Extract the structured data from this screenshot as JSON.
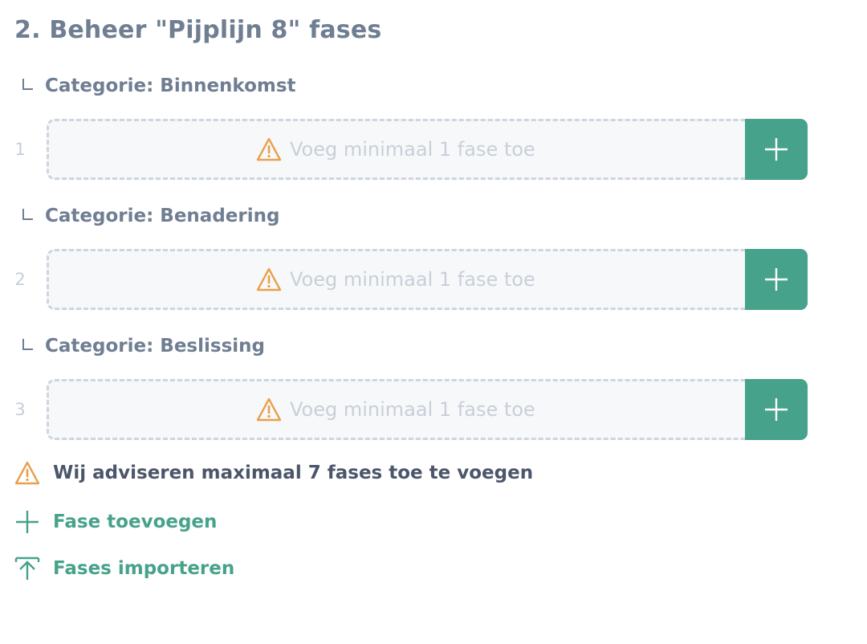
{
  "page": {
    "title": "2. Beheer \"Pijplijn 8\" fases"
  },
  "categories": [
    {
      "label": "Categorie: Binnenkomst",
      "row_number": "1",
      "placeholder": "Voeg minimaal 1 fase toe"
    },
    {
      "label": "Categorie: Benadering",
      "row_number": "2",
      "placeholder": "Voeg minimaal 1 fase toe"
    },
    {
      "label": "Categorie: Beslissing",
      "row_number": "3",
      "placeholder": "Voeg minimaal 1 fase toe"
    }
  ],
  "advice": {
    "text": "Wij adviseren maximaal 7 fases toe te voegen"
  },
  "actions": {
    "add_phase": "Fase toevoegen",
    "import_phases": "Fases importeren"
  },
  "icons": {
    "warning": "warning-triangle-icon",
    "plus": "plus-icon",
    "import": "upload-arrow-icon"
  },
  "colors": {
    "accent_green": "#47a28b",
    "warning_orange": "#e8a04b",
    "heading_gray": "#6f7e92",
    "placeholder_gray": "#c9cfd8",
    "dashed_border": "#cfd5de"
  }
}
